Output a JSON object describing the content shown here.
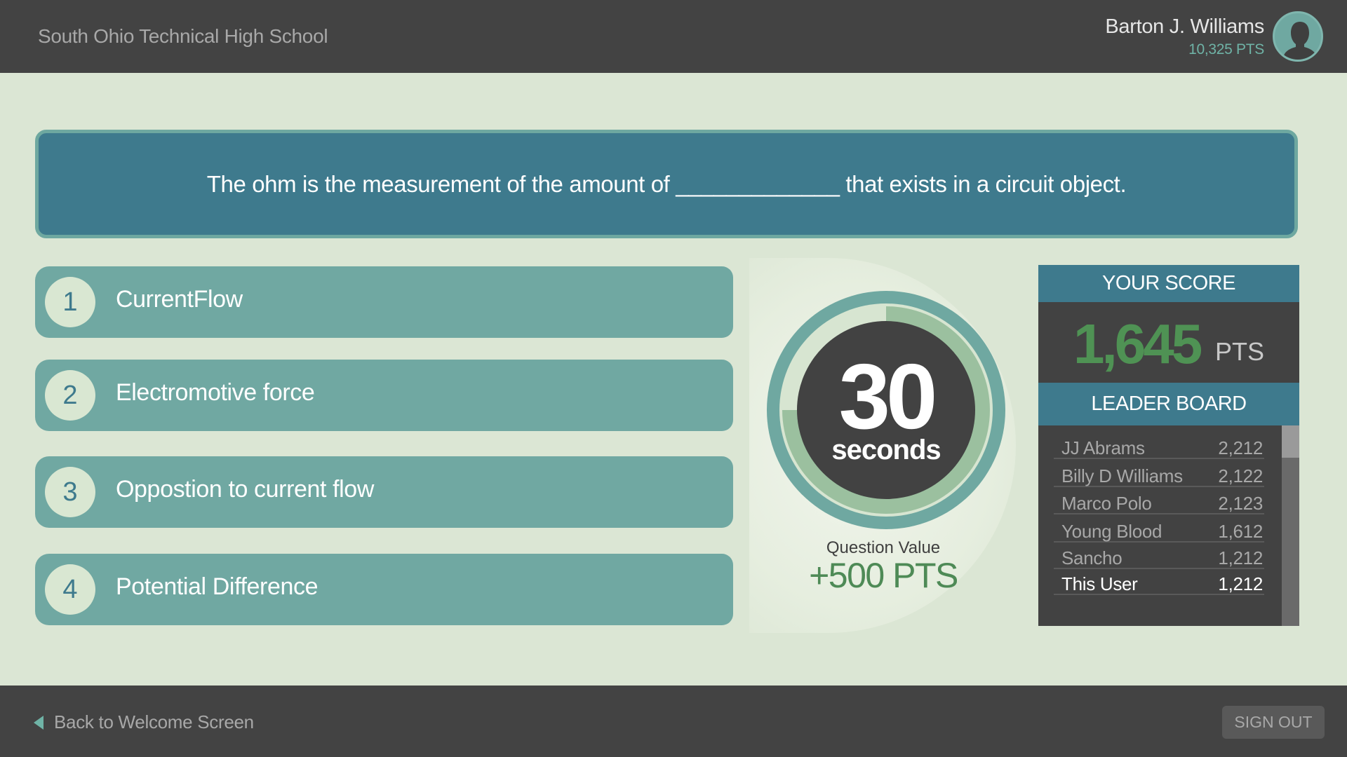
{
  "header": {
    "school": "South Ohio Technical High School",
    "user_name": "Barton J. Williams",
    "user_points": "10,325 PTS"
  },
  "question": {
    "text": "The ohm is the measurement of the amount of _____________ that exists in a circuit object."
  },
  "answers": [
    {
      "num": "1",
      "label": "CurrentFlow"
    },
    {
      "num": "2",
      "label": "Electromotive force"
    },
    {
      "num": "3",
      "label": "Oppostion to current flow"
    },
    {
      "num": "4",
      "label": "Potential Difference"
    }
  ],
  "timer": {
    "value": "30",
    "unit": "seconds",
    "remaining_fraction": 0.75,
    "question_value_label": "Question Value",
    "question_value": "+500 PTS"
  },
  "score": {
    "title": "YOUR SCORE",
    "value": "1,645",
    "unit": "PTS"
  },
  "leaderboard": {
    "title": "LEADER BOARD",
    "rows": [
      {
        "name": "JJ Abrams",
        "points": "2,212"
      },
      {
        "name": "Billy D Williams",
        "points": "2,122"
      },
      {
        "name": "Marco Polo",
        "points": "2,123"
      },
      {
        "name": "Young Blood",
        "points": "1,612"
      },
      {
        "name": "Sancho",
        "points": "1,212"
      },
      {
        "name": "This User",
        "points": "1,212"
      }
    ]
  },
  "footer": {
    "back_label": "Back to Welcome Screen",
    "signout_label": "SIGN OUT"
  },
  "colors": {
    "header_bg": "#434343",
    "main_bg": "#dbe6d4",
    "question_bg": "#3e7a8d",
    "answer_bg": "#70a8a2",
    "accent_green": "#4f9254",
    "accent_teal": "#6fb3a6"
  }
}
